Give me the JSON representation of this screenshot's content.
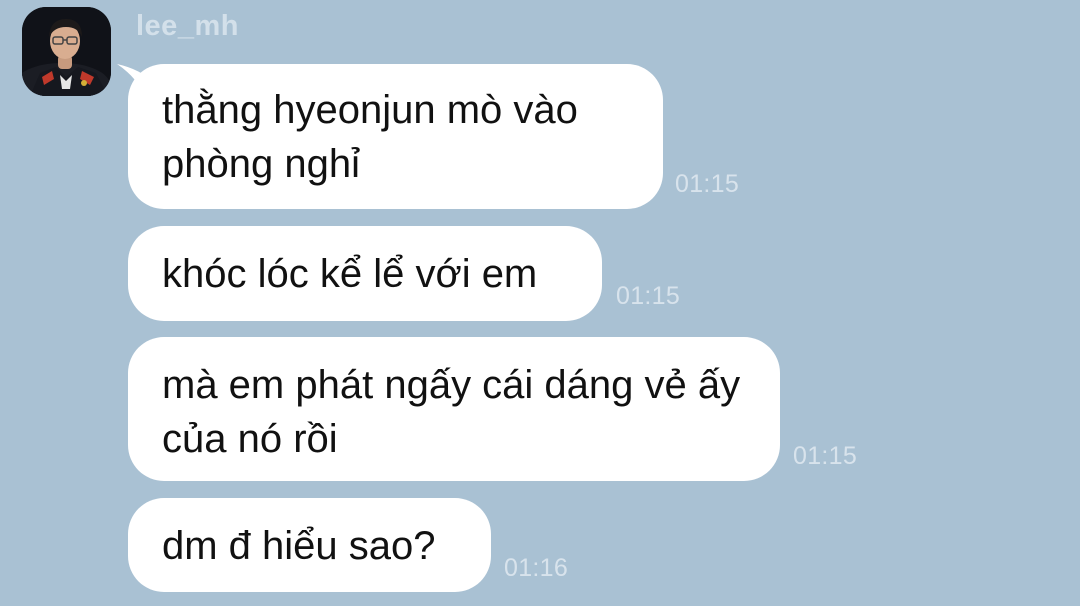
{
  "sender": {
    "name": "lee_mh",
    "avatar_icon": "user-avatar-photo"
  },
  "colors": {
    "background": "#a9c1d3",
    "bubble": "#ffffff",
    "timestamp": "#d8e3ec",
    "sender_name": "#d3e0ea"
  },
  "messages": [
    {
      "text": "thằng hyeonjun mò vào phòng nghỉ",
      "time": "01:15"
    },
    {
      "text": "khóc lóc kể lể với em",
      "time": "01:15"
    },
    {
      "text": "mà em phát ngấy cái dáng vẻ ấy của nó rồi",
      "time": "01:15"
    },
    {
      "text": "dm đ hiểu sao?",
      "time": "01:16"
    }
  ]
}
